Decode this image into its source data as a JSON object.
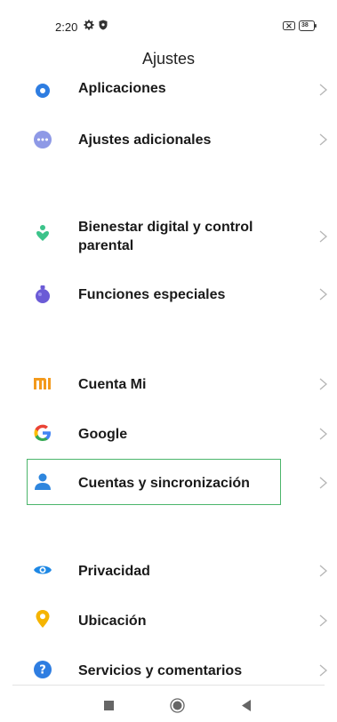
{
  "status_bar": {
    "time": "2:20",
    "battery": "38"
  },
  "header": {
    "title": "Ajustes"
  },
  "items": [
    {
      "label": "Aplicaciones",
      "icon": "apps-gear-icon",
      "color": "#2e7de1"
    },
    {
      "label": "Ajustes adicionales",
      "icon": "more-dots-icon",
      "color": "#8e99e6"
    },
    {
      "label": "Bienestar digital y control",
      "label2": "parental",
      "icon": "digital-wellbeing-icon",
      "color": "#3cc38a"
    },
    {
      "label": "Funciones especiales",
      "icon": "special-features-icon",
      "color": "#6b5bd6"
    },
    {
      "label": "Cuenta Mi",
      "icon": "mi-logo-icon",
      "color": "#f39a1d"
    },
    {
      "label": "Google",
      "icon": "google-icon",
      "color": "#4285f4"
    },
    {
      "label": "Cuentas y sincronización",
      "icon": "account-person-icon",
      "color": "#2e86de"
    },
    {
      "label": "Privacidad",
      "icon": "eye-icon",
      "color": "#1e88e5"
    },
    {
      "label": "Ubicación",
      "icon": "location-pin-icon",
      "color": "#f5b400"
    },
    {
      "label": "Servicios y comentarios",
      "icon": "help-question-icon",
      "color": "#2e7de1"
    }
  ],
  "highlight_color": "#4bb56b"
}
